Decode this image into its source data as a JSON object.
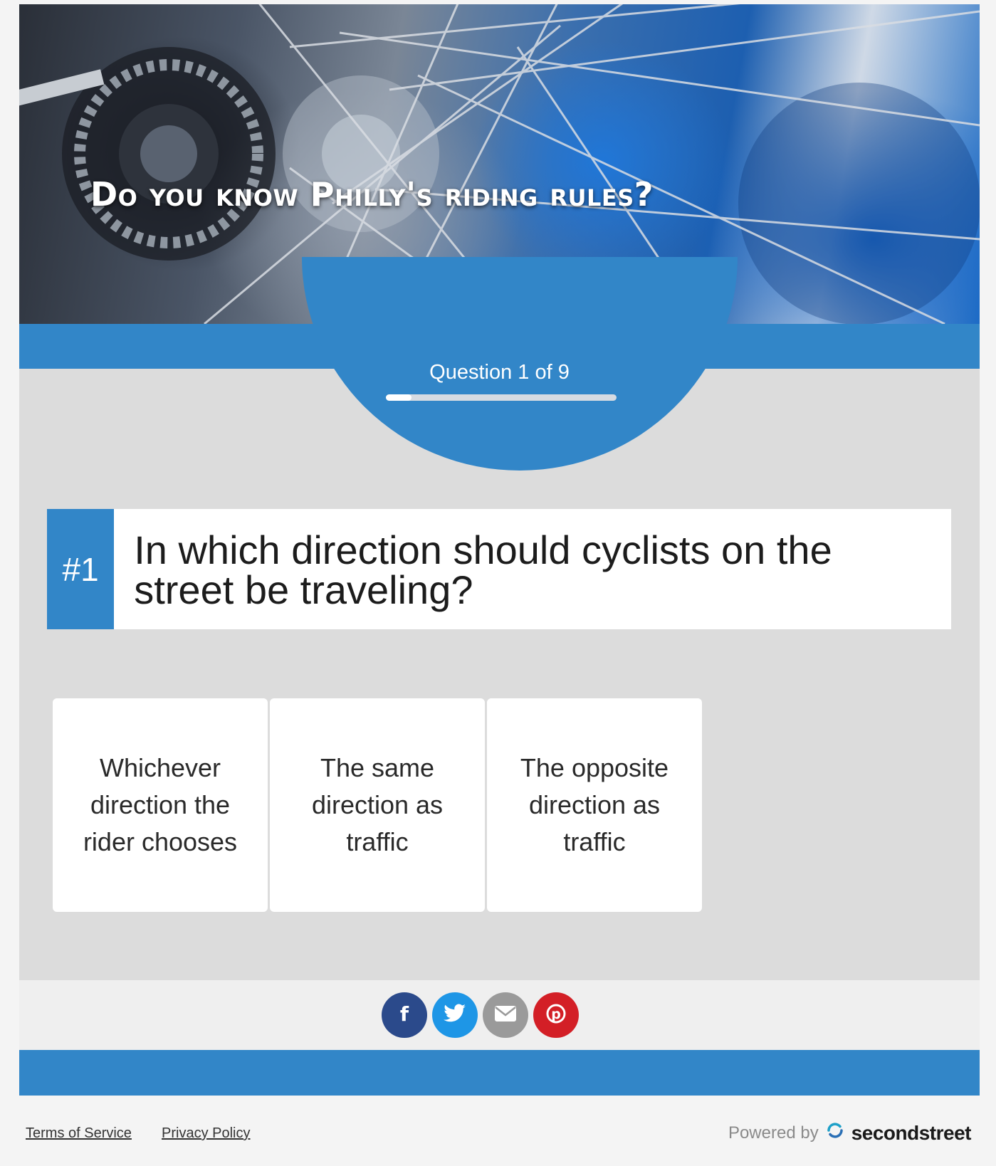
{
  "hero": {
    "title": "Do you know Philly's riding rules?"
  },
  "progress": {
    "counter": "Question 1 of 9",
    "current": 1,
    "total": 9
  },
  "question": {
    "number": "#1",
    "text": "In which direction should cyclists on the street be traveling?"
  },
  "answers": [
    {
      "label": "Whichever direction the rider chooses"
    },
    {
      "label": "The same direction as traffic"
    },
    {
      "label": "The opposite direction as traffic"
    }
  ],
  "social": [
    {
      "name": "facebook",
      "icon": "facebook-icon",
      "color": "#2b4a8b"
    },
    {
      "name": "twitter",
      "icon": "twitter-icon",
      "color": "#1e96e6"
    },
    {
      "name": "email",
      "icon": "email-icon",
      "color": "#9a9a9a"
    },
    {
      "name": "pinterest",
      "icon": "pinterest-icon",
      "color": "#d31f26"
    }
  ],
  "footer": {
    "terms": "Terms of Service",
    "privacy": "Privacy Policy",
    "powered_by": "Powered by",
    "brand": "secondstreet"
  },
  "colors": {
    "accent": "#3286c8",
    "background": "#dcdcdc"
  }
}
